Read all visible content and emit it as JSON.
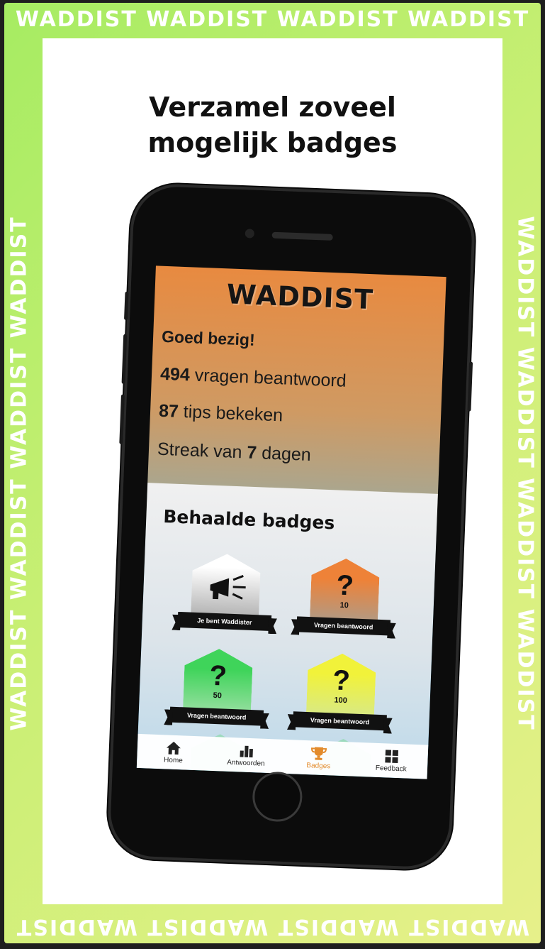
{
  "frame": {
    "border_text": "WADDIST WADDIST WADDIST WADDIST",
    "headline_line1": "Verzamel zoveel",
    "headline_line2": "mogelijk badges",
    "colors": {
      "frame_start": "#a6ec62",
      "frame_end": "#e7f08a"
    }
  },
  "app": {
    "title": "WADDIST",
    "greeting": "Goed bezig!",
    "stats": {
      "questions_count": "494",
      "questions_label": " vragen beantwoord",
      "tips_count": "87",
      "tips_label": " tips bekeken",
      "streak_prefix": "Streak van ",
      "streak_count": "7",
      "streak_suffix": " dagen"
    },
    "badges": {
      "title": "Behaalde badges",
      "items": [
        {
          "label": "Je bent Waddister",
          "icon": "megaphone-icon"
        },
        {
          "label": "Vragen beantwoord",
          "value": "10",
          "icon": "question-icon"
        },
        {
          "label": "Vragen beantwoord",
          "value": "50",
          "icon": "question-icon"
        },
        {
          "label": "Vragen beantwoord",
          "value": "100",
          "icon": "question-icon"
        }
      ],
      "question_mark": "?"
    },
    "tabbar": [
      {
        "label": "Home",
        "icon": "home-icon"
      },
      {
        "label": "Antwoorden",
        "icon": "bar-chart-icon"
      },
      {
        "label": "Badges",
        "icon": "trophy-icon",
        "active": true
      },
      {
        "label": "Feedback",
        "icon": "grid-icon"
      }
    ],
    "colors": {
      "accent": "#e38b2c"
    }
  }
}
